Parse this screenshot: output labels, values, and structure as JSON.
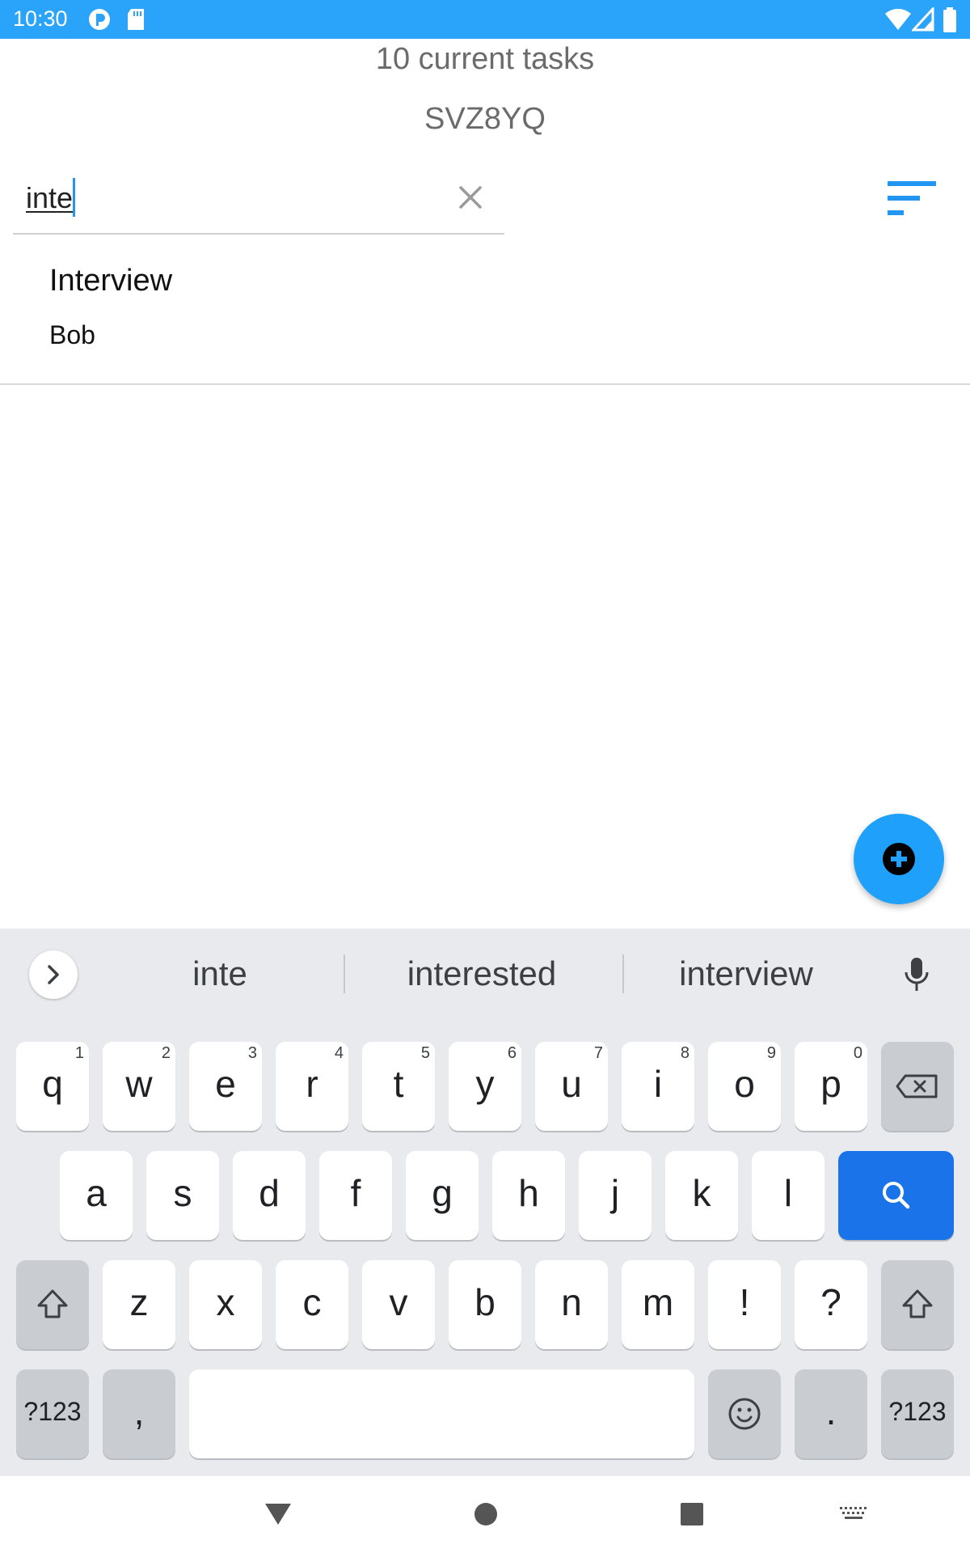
{
  "status_bar": {
    "time": "10:30",
    "left_icons": [
      "notification-badge-icon",
      "sd-card-icon"
    ],
    "right_icons": [
      "wifi-icon",
      "cell-signal-icon",
      "battery-icon"
    ],
    "background": "#2aa3fb"
  },
  "header": {
    "tasks_count": "10 current tasks",
    "code": "SVZ8YQ"
  },
  "search": {
    "value": "inte",
    "clear_icon": "close-icon",
    "sort_icon": "sort-icon"
  },
  "results": [
    {
      "title": "Interview",
      "subtitle": "Bob"
    }
  ],
  "fab": {
    "icon": "add-circle-icon",
    "color": "#1ea0fb"
  },
  "keyboard": {
    "suggestions": [
      "inte",
      "interested",
      "interview"
    ],
    "expand_icon": "chevron-right-icon",
    "mic_icon": "microphone-icon",
    "row1": [
      {
        "label": "q",
        "hint": "1"
      },
      {
        "label": "w",
        "hint": "2"
      },
      {
        "label": "e",
        "hint": "3"
      },
      {
        "label": "r",
        "hint": "4"
      },
      {
        "label": "t",
        "hint": "5"
      },
      {
        "label": "y",
        "hint": "6"
      },
      {
        "label": "u",
        "hint": "7"
      },
      {
        "label": "i",
        "hint": "8"
      },
      {
        "label": "o",
        "hint": "9"
      },
      {
        "label": "p",
        "hint": "0"
      }
    ],
    "row2": [
      "a",
      "s",
      "d",
      "f",
      "g",
      "h",
      "j",
      "k",
      "l"
    ],
    "row3": [
      "z",
      "x",
      "c",
      "v",
      "b",
      "n",
      "m",
      "!",
      "?"
    ],
    "symbols_label": "?123",
    "comma_label": ",",
    "period_label": ".",
    "accent_color": "#1a73e8"
  },
  "nav_bar": {
    "icons": [
      "back-icon",
      "home-icon",
      "recents-icon",
      "keyboard-switch-icon"
    ]
  }
}
